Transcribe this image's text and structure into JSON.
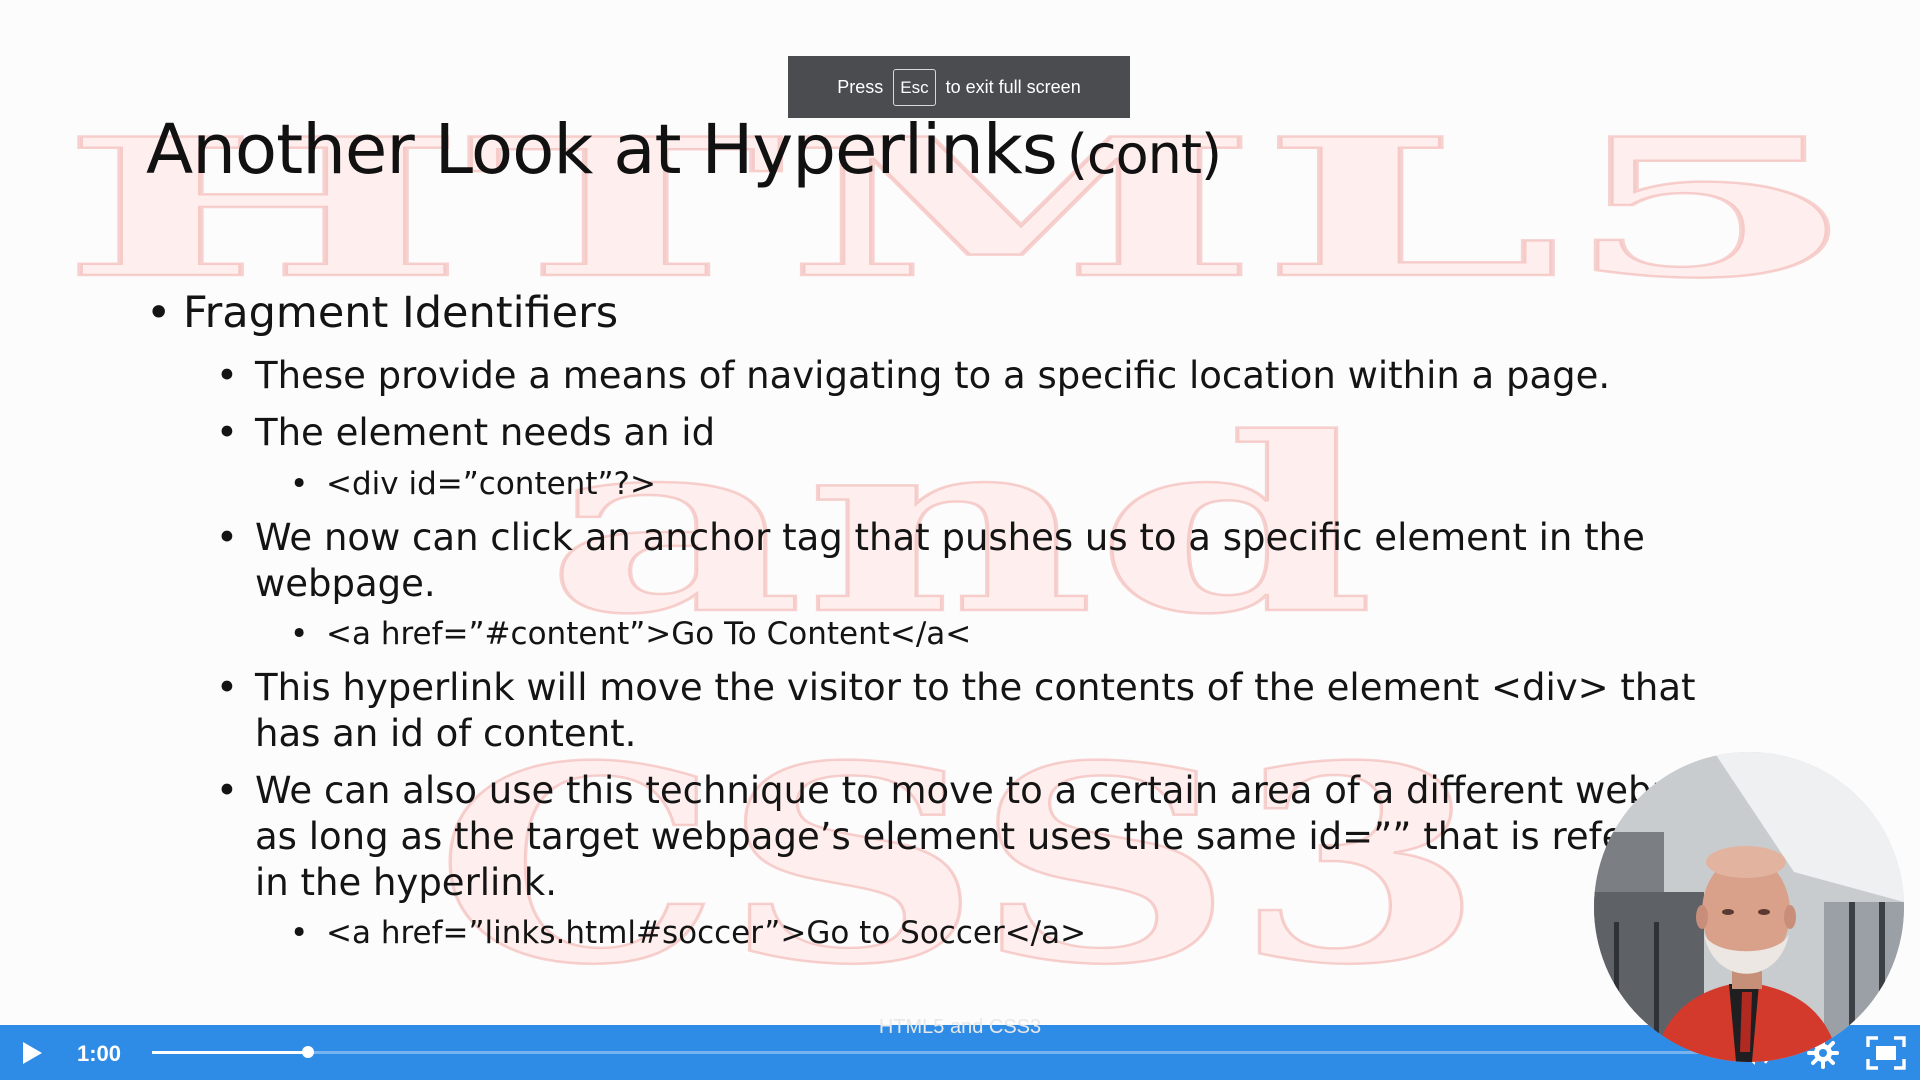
{
  "toast": {
    "press": "Press",
    "key": "Esc",
    "rest": "to exit full screen"
  },
  "slide": {
    "title": "Another Look at Hyperlinks",
    "title_suffix": "(cont)",
    "watermark": {
      "line1": "HTML5",
      "line2": "and",
      "line3": "CSS3"
    },
    "bullets": {
      "l1_fragment": "Fragment Identifiers",
      "l2_provide": "These provide a means of navigating to a specific location within a page.",
      "l2_needs_id": "The element needs an id",
      "l3_div": "<div id=”content”?>",
      "l2_click": "We now can click an anchor tag that pushes us to a specific element in the webpage.",
      "l3_anchor": "<a href=”#content”>Go To Content</a<",
      "l2_move": "This hyperlink will move the visitor to the contents of the element <div> that has an id of content.",
      "l2_also": "We can also use this technique to move to a certain area of a different webpage as long as the target webpage’s element uses the same id=”” that is referenced in the hyperlink.",
      "l3_soccer": "<a href=”links.html#soccer”>Go to Soccer</a>"
    },
    "footer": "HTML5 and CSS3"
  },
  "player": {
    "current_time": "1:00",
    "progress_fraction": 0.1,
    "accent_color": "#2f8ce6",
    "icons": [
      "play-icon",
      "volume-icon",
      "settings-icon",
      "fullscreen-exit-icon"
    ]
  }
}
